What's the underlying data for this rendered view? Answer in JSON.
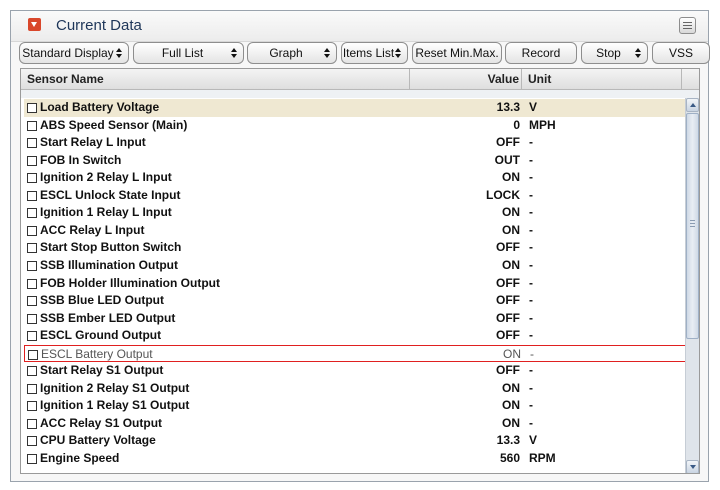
{
  "panel": {
    "title": "Current Data"
  },
  "toolbar": {
    "buttons": [
      {
        "label": "Standard Display",
        "dropdown": true
      },
      {
        "label": "Full List",
        "dropdown": true
      },
      {
        "label": "Graph",
        "dropdown": true
      },
      {
        "label": "Items List",
        "dropdown": true
      },
      {
        "label": "Reset Min.Max.",
        "dropdown": false
      },
      {
        "label": "Record",
        "dropdown": false
      },
      {
        "label": "Stop",
        "dropdown": true
      },
      {
        "label": "VSS",
        "dropdown": false
      }
    ]
  },
  "table": {
    "columns": {
      "name": "Sensor Name",
      "value": "Value",
      "unit": "Unit"
    },
    "selected_index": 14,
    "rows": [
      {
        "name": "Load Battery Voltage",
        "value": "13.3",
        "unit": "V"
      },
      {
        "name": "ABS Speed Sensor (Main)",
        "value": "0",
        "unit": "MPH"
      },
      {
        "name": "Start Relay L Input",
        "value": "OFF",
        "unit": "-"
      },
      {
        "name": "FOB In Switch",
        "value": "OUT",
        "unit": "-"
      },
      {
        "name": "Ignition 2 Relay L Input",
        "value": "ON",
        "unit": "-"
      },
      {
        "name": "ESCL Unlock State Input",
        "value": "LOCK",
        "unit": "-"
      },
      {
        "name": "Ignition 1 Relay L Input",
        "value": "ON",
        "unit": "-"
      },
      {
        "name": "ACC Relay L Input",
        "value": "ON",
        "unit": "-"
      },
      {
        "name": "Start Stop Button Switch",
        "value": "OFF",
        "unit": "-"
      },
      {
        "name": "SSB Illumination Output",
        "value": "ON",
        "unit": "-"
      },
      {
        "name": "FOB Holder Illumination Output",
        "value": "OFF",
        "unit": "-"
      },
      {
        "name": "SSB Blue LED Output",
        "value": "OFF",
        "unit": "-"
      },
      {
        "name": "SSB Ember LED Output",
        "value": "OFF",
        "unit": "-"
      },
      {
        "name": "ESCL Ground Output",
        "value": "OFF",
        "unit": "-"
      },
      {
        "name": "ESCL Battery Output",
        "value": "ON",
        "unit": "-"
      },
      {
        "name": "Start Relay S1 Output",
        "value": "OFF",
        "unit": "-"
      },
      {
        "name": "Ignition 2 Relay S1 Output",
        "value": "ON",
        "unit": "-"
      },
      {
        "name": "Ignition 1 Relay S1 Output",
        "value": "ON",
        "unit": "-"
      },
      {
        "name": "ACC Relay S1 Output",
        "value": "ON",
        "unit": "-"
      },
      {
        "name": "CPU Battery Voltage",
        "value": "13.3",
        "unit": "V"
      },
      {
        "name": "Engine Speed",
        "value": "560",
        "unit": "RPM"
      }
    ]
  },
  "colors": {
    "title_text": "#1e3659",
    "collapse_button": "#d9472b",
    "first_row_highlight": "#efe8d2",
    "selection_border": "#e02020"
  },
  "icons": {
    "collapse": "collapse-arrow-icon",
    "menu": "panel-menu-icon",
    "row_checkbox": "checkbox-icon",
    "dropdown": "dropdown-arrows-icon"
  }
}
